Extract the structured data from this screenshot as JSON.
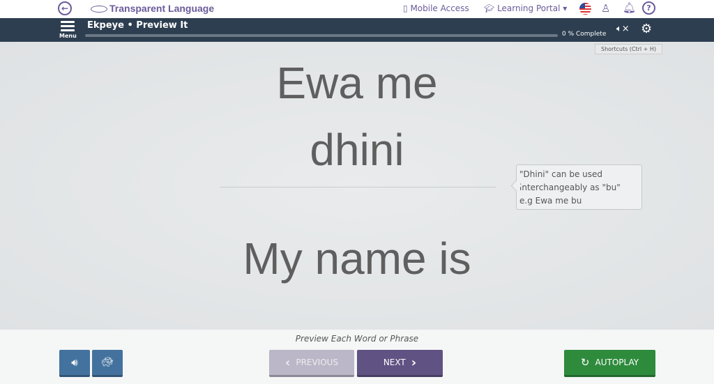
{
  "header": {
    "logo_text": "Transparent Language",
    "mobile_access": "Mobile Access",
    "learning_portal": "Learning Portal",
    "icons": [
      "back-arrow-icon",
      "mobile-icon",
      "graduation-cap-icon",
      "us-flag-icon",
      "user-icon",
      "bell-icon",
      "help-icon"
    ]
  },
  "nav": {
    "menu_label": "Menu",
    "title": "Ekpeye • Preview It",
    "progress_percent": 0,
    "progress_text": "0 % Complete",
    "shortcuts": "Shortcuts  (Ctrl + H)"
  },
  "card": {
    "target": "Ewa me",
    "target2": "dhini",
    "native": "My name is",
    "note_line1": "\"Dhini\" can be used",
    "note_line2": "interchangeably as \"bu\"",
    "note_line3": "e.g Ewa me bu"
  },
  "footer": {
    "instruction": "Preview Each Word or Phrase",
    "previous": "PREVIOUS",
    "next": "NEXT",
    "autoplay": "AUTOPLAY"
  },
  "colors": {
    "navbar": "#2d3e50",
    "accent": "#6a5b9a",
    "next": "#605283",
    "autoplay": "#2e8b3c",
    "audio": "#44729e"
  }
}
